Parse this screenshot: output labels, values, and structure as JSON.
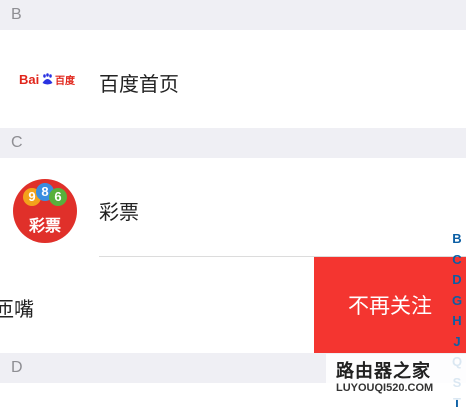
{
  "sections": [
    {
      "letter": "B"
    },
    {
      "letter": "C"
    },
    {
      "letter": "D"
    }
  ],
  "items": [
    {
      "label": "百度首页",
      "icon": "baidu-logo-icon",
      "logo_text": "Bai",
      "logo_text2": "百度"
    },
    {
      "label": "彩票",
      "icon": "lottery-icon",
      "balls": [
        "9",
        "8",
        "6"
      ],
      "icon_text": "彩票"
    },
    {
      "label": "匝嘴",
      "icon": "none"
    }
  ],
  "swipe_action": {
    "label": "不再关注",
    "color": "#f43530"
  },
  "index_bar": [
    "B",
    "C",
    "D",
    "G",
    "H",
    "J",
    "Q",
    "S",
    "T"
  ],
  "watermark": {
    "title": "路由器之家",
    "url": "LUYOUQI520.COM"
  },
  "colors": {
    "section_bg": "#efeff4",
    "index": "#0b5fa5",
    "baidu_red": "#e1251b",
    "baidu_blue": "#2932e1"
  }
}
